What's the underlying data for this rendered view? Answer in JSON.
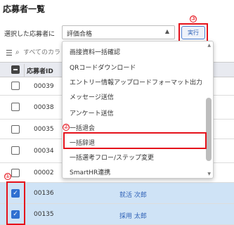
{
  "page": {
    "title": "応募者一覧"
  },
  "bulk_action": {
    "label": "選択した応募者に",
    "selected_value": "評価合格",
    "run_label": "実行"
  },
  "toolbar": {
    "search_placeholder": "すべてのカラ"
  },
  "table": {
    "header_id": "応募者ID",
    "rows": [
      {
        "id": "00039",
        "name": "",
        "checked": false
      },
      {
        "id": "00038",
        "name": "",
        "checked": false
      },
      {
        "id": "00035",
        "name": "",
        "checked": false
      },
      {
        "id": "00034",
        "name": "",
        "checked": false
      },
      {
        "id": "00002",
        "name": "",
        "checked": false
      },
      {
        "id": "00136",
        "name": "就活 次郎",
        "checked": true
      },
      {
        "id": "00135",
        "name": "採用 太郎",
        "checked": true
      }
    ]
  },
  "dropdown": {
    "items": [
      "画接資料一括確認",
      "QRコードダウンロード",
      "エントリー情報アップロードフォーマット出力",
      "メッセージ送信",
      "アンケート送信",
      "一括退会",
      "一括辞退",
      "一括選考フロー/ステップ変更",
      "SmartHR連携"
    ],
    "highlighted_index": 6
  },
  "callouts": {
    "one": "①",
    "two": "②",
    "three": "③"
  },
  "colors": {
    "highlight": "#e5121b",
    "selected_row": "#cfe3f6",
    "accent": "#2f6fd0"
  }
}
